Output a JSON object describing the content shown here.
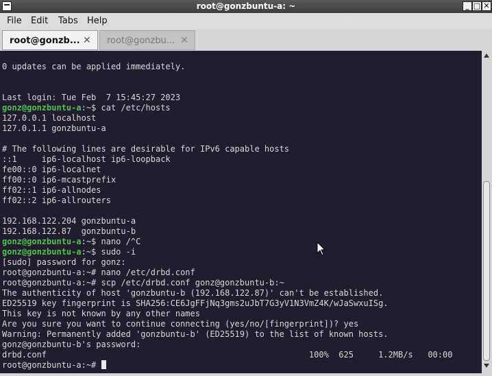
{
  "window": {
    "title": "root@gonzbuntu-a: ~"
  },
  "menu": [
    "File",
    "Edit",
    "Tabs",
    "Help"
  ],
  "tabs": [
    {
      "label": "root@gonzb...",
      "close": "✕"
    },
    {
      "label": "root@gonzbu...",
      "close": "✕"
    }
  ],
  "terminal": {
    "lines": [
      {
        "text": "0 updates can be applied immediately."
      },
      {
        "text": ""
      },
      {
        "text": ""
      },
      {
        "text": "Last login: Tue Feb  7 15:45:27 2023"
      },
      {
        "prompt_user": "gonz@gonzbuntu-a",
        "prompt_rest": ":~$ ",
        "text": "cat /etc/hosts"
      },
      {
        "text": "127.0.0.1 localhost"
      },
      {
        "text": "127.0.1.1 gonzbuntu-a"
      },
      {
        "text": ""
      },
      {
        "text": "# The following lines are desirable for IPv6 capable hosts"
      },
      {
        "text": "::1     ip6-localhost ip6-loopback"
      },
      {
        "text": "fe00::0 ip6-localnet"
      },
      {
        "text": "ff00::0 ip6-mcastprefix"
      },
      {
        "text": "ff02::1 ip6-allnodes"
      },
      {
        "text": "ff02::2 ip6-allrouters"
      },
      {
        "text": ""
      },
      {
        "text": "192.168.122.204 gonzbuntu-a"
      },
      {
        "text": "192.168.122.87  gonzbuntu-b"
      },
      {
        "prompt_user": "gonz@gonzbuntu-a",
        "prompt_rest": ":~$ ",
        "text": "nano /^C"
      },
      {
        "prompt_user": "gonz@gonzbuntu-a",
        "prompt_rest": ":~$ ",
        "text": "sudo -i"
      },
      {
        "text": "[sudo] password for gonz:"
      },
      {
        "text": "root@gonzbuntu-a:~# nano /etc/drbd.conf"
      },
      {
        "text": "root@gonzbuntu-a:~# scp /etc/drbd.conf gonz@gonzbuntu-b:~"
      },
      {
        "text": "The authenticity of host 'gonzbuntu-b (192.168.122.87)' can't be established."
      },
      {
        "text": "ED25519 key fingerprint is SHA256:CE6JgFFjNq3gms2uJbT7G3yV1N3VmZ4K/wJaSwxuISg."
      },
      {
        "text": "This key is not known by any other names"
      },
      {
        "text": "Are you sure you want to continue connecting (yes/no/[fingerprint])? yes"
      },
      {
        "text": "Warning: Permanently added 'gonzbuntu-b' (ED25519) to the list of known hosts."
      },
      {
        "text": "gonz@gonzbuntu-b's password:"
      },
      {
        "text": "drbd.conf                                                     100%  625     1.2MB/s   00:00"
      },
      {
        "text": "root@gonzbuntu-a:~# ",
        "cursor": true
      }
    ]
  },
  "colors": {
    "terminal_bg": "#211c2e",
    "terminal_fg": "#d8d8d8",
    "prompt_green": "#4ec34e"
  },
  "icons": [
    "window-menu-icon",
    "minimize-icon",
    "maximize-icon",
    "close-icon",
    "mouse-pointer-icon"
  ]
}
